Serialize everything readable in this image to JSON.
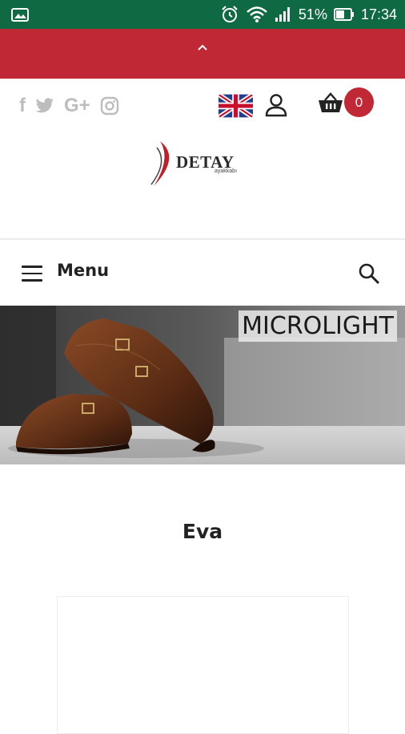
{
  "status_bar": {
    "battery": "51%",
    "time": "17:34",
    "icons": [
      "gallery-icon",
      "alarm-icon",
      "wifi-icon",
      "signal-icon",
      "battery-icon"
    ]
  },
  "banner": {
    "icon": "chevron-up-icon",
    "color": "#bf2834"
  },
  "header": {
    "social_icons": [
      "facebook-icon",
      "twitter-icon",
      "google-plus-icon",
      "instagram-icon"
    ],
    "language_icon": "uk-flag-icon",
    "account_icon": "user-icon",
    "cart_icon": "basket-icon",
    "cart_count": "0"
  },
  "logo": {
    "word": "DETAY",
    "sub": "ayakkabı"
  },
  "nav": {
    "menu_label": "Menu",
    "search_icon": "search-icon"
  },
  "hero": {
    "title": "MICROLIGHT"
  },
  "category": {
    "title": "Eva"
  },
  "colors": {
    "status": "#0f6a43",
    "accent": "#bf2834",
    "text": "#222222",
    "muted": "#bdbdbd"
  }
}
